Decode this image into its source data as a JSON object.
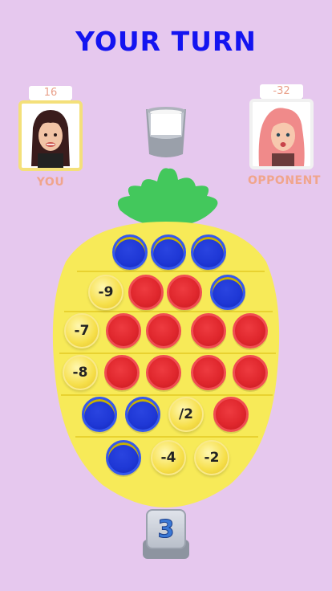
{
  "header": {
    "title": "YOUR TURN"
  },
  "players": {
    "you": {
      "score": "16",
      "name": "YOU"
    },
    "opponent": {
      "score": "-32",
      "name": "OPPONENT"
    }
  },
  "die": {
    "value": "3"
  },
  "board": {
    "rows": [
      [
        "blue",
        "blue",
        "blue"
      ],
      [
        "-9",
        "red",
        "red",
        "blue"
      ],
      [
        "-7",
        "red",
        "red",
        "red",
        "red"
      ],
      [
        "-8",
        "red",
        "red",
        "red",
        "red"
      ],
      [
        "blue",
        "blue",
        "/2",
        "red"
      ],
      [
        "blue",
        "-4",
        "-2"
      ]
    ]
  },
  "colors": {
    "background": "#e6c8ee",
    "title": "#1414f0",
    "board": "#f7ea58",
    "leaves": "#3ec85a",
    "blue": "#1f38d6",
    "red": "#e0272d"
  },
  "icons": [
    "cup-icon",
    "die-icon",
    "you-avatar",
    "opponent-avatar",
    "pineapple-leaves"
  ]
}
